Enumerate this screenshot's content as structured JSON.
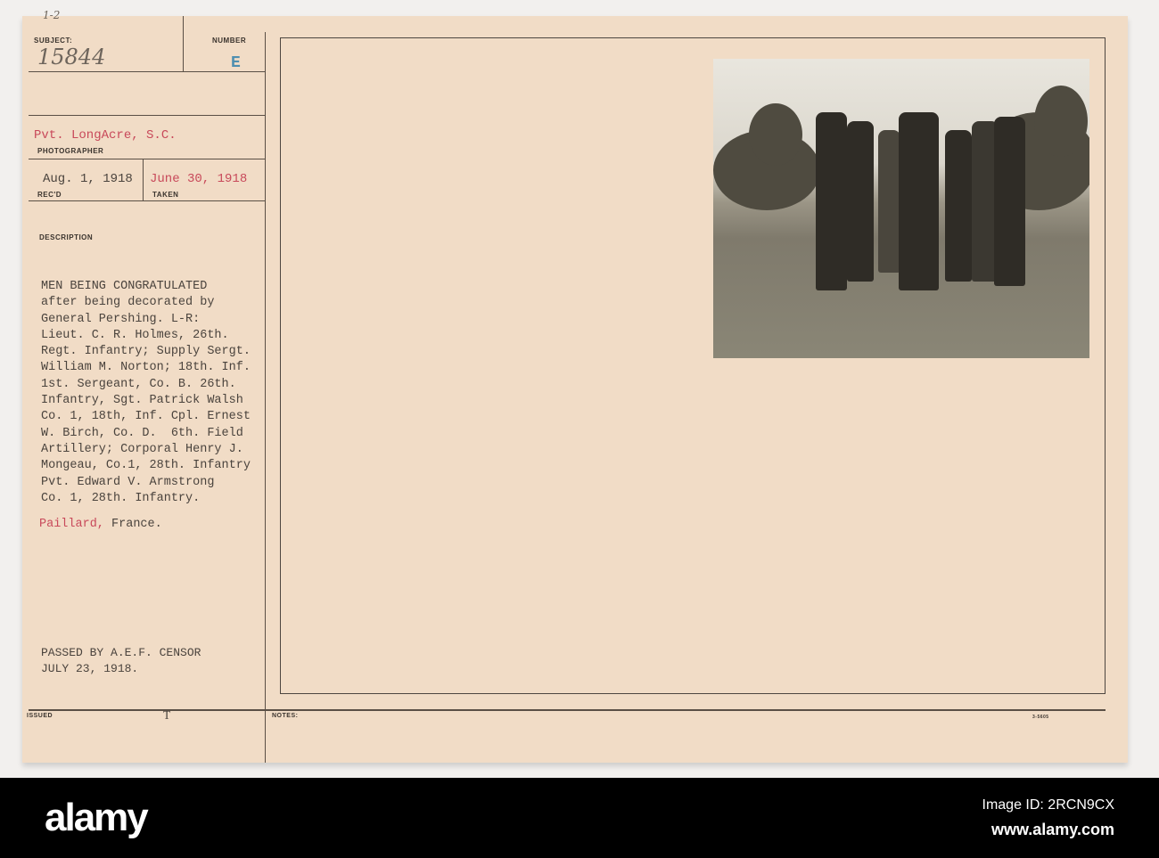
{
  "card": {
    "top_note": "1-2",
    "subject_label": "SUBJECT:",
    "subject_number": "15844",
    "number_label": "NUMBER",
    "number_value": "E",
    "photographer": "Pvt. LongAcre, S.C.",
    "photographer_label": "PHOTOGRAPHER",
    "received": "Aug. 1, 1918",
    "received_label": "REC'D",
    "taken": "June 30, 1918",
    "taken_label": "TAKEN",
    "description_label": "DESCRIPTION",
    "description_lines": [
      "MEN BEING CONGRATULATED",
      "after being decorated by",
      "General Pershing. L-R:",
      "Lieut. C. R. Holmes, 26th.",
      "Regt. Infantry; Supply Sergt.",
      "William M. Norton; 18th. Inf.",
      "1st. Sergeant, Co. B. 26th.",
      "Infantry, Sgt. Patrick Walsh",
      "Co. 1, 18th, Inf. Cpl. Ernest",
      "W. Birch, Co. D.  6th. Field",
      "Artillery; Corporal Henry J.",
      "Mongeau, Co.1, 28th. Infantry",
      "Pvt. Edward V. Armstrong",
      "Co. 1, 28th. Infantry."
    ],
    "location_place": "Paillard,",
    "location_country": " France.",
    "censor_line1": "PASSED BY A.E.F. CENSOR",
    "censor_line2": "JULY 23, 1918.",
    "issued_label": "ISSUED",
    "issued_mark": "T",
    "notes_label": "NOTES:",
    "form_number": "3-5605"
  },
  "footer": {
    "logo": "alamy",
    "image_id": "Image ID: 2RCN9CX",
    "url": "www.alamy.com"
  }
}
